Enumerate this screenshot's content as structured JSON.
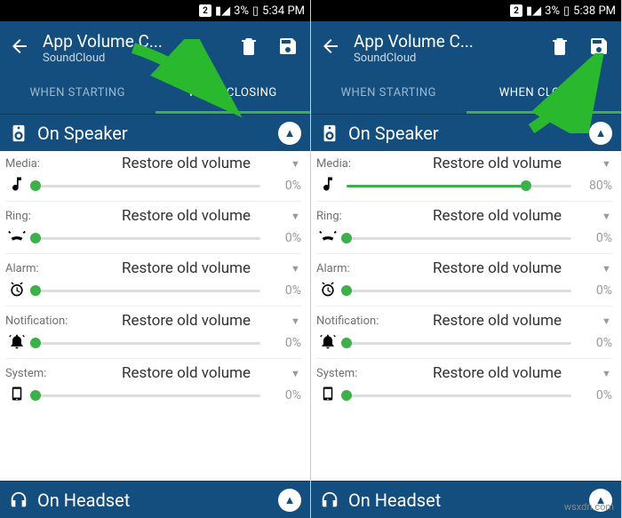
{
  "watermark": "wsxdn.com",
  "panels": [
    {
      "status": {
        "sim": "2",
        "battery_pct": "3%",
        "time": "5:34 PM"
      },
      "appbar": {
        "title": "App Volume C...",
        "subtitle": "SoundCloud"
      },
      "tabs": {
        "starting": "WHEN STARTING",
        "closing": "WHEN CLOSING",
        "active": "closing"
      },
      "sections": {
        "speaker": "On Speaker",
        "headset": "On Headset"
      },
      "rows": [
        {
          "label": "Media:",
          "action": "Restore old volume",
          "icon": "note",
          "pct": "0%",
          "val": 0
        },
        {
          "label": "Ring:",
          "action": "Restore old volume",
          "icon": "ring",
          "pct": "0%",
          "val": 0
        },
        {
          "label": "Alarm:",
          "action": "Restore old volume",
          "icon": "alarm",
          "pct": "0%",
          "val": 0
        },
        {
          "label": "Notification:",
          "action": "Restore old volume",
          "icon": "bell",
          "pct": "0%",
          "val": 0
        },
        {
          "label": "System:",
          "action": "Restore old volume",
          "icon": "phone",
          "pct": "0%",
          "val": 0
        }
      ],
      "arrow_target": "closing-tab"
    },
    {
      "status": {
        "sim": "2",
        "battery_pct": "3%",
        "time": "5:38 PM"
      },
      "appbar": {
        "title": "App Volume C...",
        "subtitle": "SoundCloud"
      },
      "tabs": {
        "starting": "WHEN STARTING",
        "closing": "WHEN CLOSING",
        "active": "closing"
      },
      "sections": {
        "speaker": "On Speaker",
        "headset": "On Headset"
      },
      "rows": [
        {
          "label": "Media:",
          "action": "Restore old volume",
          "icon": "note",
          "pct": "80%",
          "val": 80
        },
        {
          "label": "Ring:",
          "action": "Restore old volume",
          "icon": "ring",
          "pct": "0%",
          "val": 0
        },
        {
          "label": "Alarm:",
          "action": "Restore old volume",
          "icon": "alarm",
          "pct": "0%",
          "val": 0
        },
        {
          "label": "Notification:",
          "action": "Restore old volume",
          "icon": "bell",
          "pct": "0%",
          "val": 0
        },
        {
          "label": "System:",
          "action": "Restore old volume",
          "icon": "phone",
          "pct": "0%",
          "val": 0
        }
      ],
      "arrow_target": "save-button"
    }
  ]
}
